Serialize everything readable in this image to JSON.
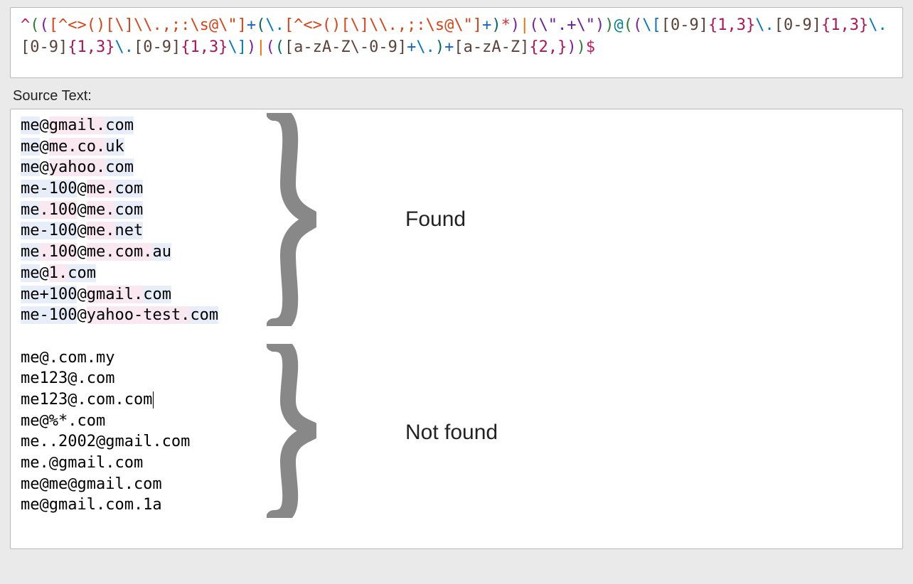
{
  "regex": {
    "tokens": [
      {
        "t": "^",
        "c": "c-anchor"
      },
      {
        "t": "(",
        "c": "c-group"
      },
      {
        "t": "(",
        "c": "c-group2"
      },
      {
        "t": "[^<>()[\\]\\\\.,;:\\s@\\\"]",
        "c": "c-charcls"
      },
      {
        "t": "+",
        "c": "c-quant"
      },
      {
        "t": "(",
        "c": "c-group3"
      },
      {
        "t": "\\.",
        "c": "c-esc"
      },
      {
        "t": "[^<>()[\\]\\\\.,;:\\s@\\\"]",
        "c": "c-charcls"
      },
      {
        "t": "+",
        "c": "c-quant"
      },
      {
        "t": ")",
        "c": "c-group3"
      },
      {
        "t": "*",
        "c": "c-star"
      },
      {
        "t": ")",
        "c": "c-group2"
      },
      {
        "t": "|",
        "c": "c-alt"
      },
      {
        "t": "(",
        "c": "c-group2"
      },
      {
        "t": "\\\".+\\\"",
        "c": "c-special"
      },
      {
        "t": ")",
        "c": "c-group2"
      },
      {
        "t": ")",
        "c": "c-group"
      },
      {
        "t": "@",
        "c": "c-at"
      },
      {
        "t": "(",
        "c": "c-group"
      },
      {
        "t": "(",
        "c": "c-group2"
      },
      {
        "t": "\\[",
        "c": "c-esc"
      },
      {
        "t": "[0-9]",
        "c": "c-charcls2"
      },
      {
        "t": "{1,3}",
        "c": "c-quant2"
      },
      {
        "t": "\\.",
        "c": "c-esc"
      },
      {
        "t": "[0-9]",
        "c": "c-charcls2"
      },
      {
        "t": "{1,3}",
        "c": "c-quant2"
      },
      {
        "t": "\\.",
        "c": "c-esc"
      },
      {
        "t": "[0-9]",
        "c": "c-charcls2"
      },
      {
        "t": "{1,3}",
        "c": "c-quant2"
      },
      {
        "t": "\\.",
        "c": "c-esc"
      },
      {
        "t": "[0-9]",
        "c": "c-charcls2"
      },
      {
        "t": "{1,3}",
        "c": "c-quant2"
      },
      {
        "t": "\\]",
        "c": "c-esc"
      },
      {
        "t": ")",
        "c": "c-group2"
      },
      {
        "t": "|",
        "c": "c-alt"
      },
      {
        "t": "(",
        "c": "c-group2"
      },
      {
        "t": "(",
        "c": "c-group3"
      },
      {
        "t": "[a-zA-Z\\-0-9]",
        "c": "c-charcls2"
      },
      {
        "t": "+",
        "c": "c-quant"
      },
      {
        "t": "\\.",
        "c": "c-esc"
      },
      {
        "t": ")",
        "c": "c-group3"
      },
      {
        "t": "+",
        "c": "c-quant"
      },
      {
        "t": "[a-zA-Z]",
        "c": "c-charcls2"
      },
      {
        "t": "{2,}",
        "c": "c-quant2"
      },
      {
        "t": ")",
        "c": "c-group2"
      },
      {
        "t": ")",
        "c": "c-group"
      },
      {
        "t": "$",
        "c": "c-end"
      }
    ]
  },
  "labels": {
    "source_text": "Source Text:",
    "found": "Found",
    "not_found": "Not found"
  },
  "found_rows": [
    {
      "segments": [
        {
          "t": "me",
          "h": "b"
        },
        {
          "t": "@",
          "h": ""
        },
        {
          "t": "gmail.",
          "h": "p"
        },
        {
          "t": "com",
          "h": "b"
        }
      ]
    },
    {
      "segments": [
        {
          "t": "me",
          "h": "b"
        },
        {
          "t": "@",
          "h": ""
        },
        {
          "t": "me.co.",
          "h": "p"
        },
        {
          "t": "uk",
          "h": "b"
        }
      ]
    },
    {
      "segments": [
        {
          "t": "me",
          "h": "b"
        },
        {
          "t": "@",
          "h": ""
        },
        {
          "t": "yahoo.",
          "h": "p"
        },
        {
          "t": "com",
          "h": "b"
        }
      ]
    },
    {
      "segments": [
        {
          "t": "me-100",
          "h": "b"
        },
        {
          "t": "@",
          "h": ""
        },
        {
          "t": "me.",
          "h": "p"
        },
        {
          "t": "com",
          "h": "b"
        }
      ]
    },
    {
      "segments": [
        {
          "t": "me",
          "h": "b"
        },
        {
          "t": ".100",
          "h": "p"
        },
        {
          "t": "@",
          "h": ""
        },
        {
          "t": "me.",
          "h": "p"
        },
        {
          "t": "com",
          "h": "b"
        }
      ]
    },
    {
      "segments": [
        {
          "t": "me-100",
          "h": "b"
        },
        {
          "t": "@",
          "h": ""
        },
        {
          "t": "me.",
          "h": "p"
        },
        {
          "t": "net",
          "h": "b"
        }
      ]
    },
    {
      "segments": [
        {
          "t": "me",
          "h": "b"
        },
        {
          "t": ".100",
          "h": "p"
        },
        {
          "t": "@",
          "h": ""
        },
        {
          "t": "me.com.",
          "h": "p"
        },
        {
          "t": "au",
          "h": "b"
        }
      ]
    },
    {
      "segments": [
        {
          "t": "me",
          "h": "b"
        },
        {
          "t": "@",
          "h": ""
        },
        {
          "t": "1.",
          "h": "p"
        },
        {
          "t": "com",
          "h": "b"
        }
      ]
    },
    {
      "segments": [
        {
          "t": "me+100",
          "h": "b"
        },
        {
          "t": "@",
          "h": ""
        },
        {
          "t": "gmail.",
          "h": "p"
        },
        {
          "t": "com",
          "h": "b"
        }
      ]
    },
    {
      "segments": [
        {
          "t": "me-100",
          "h": "b"
        },
        {
          "t": "@",
          "h": ""
        },
        {
          "t": "yahoo-test.",
          "h": "p"
        },
        {
          "t": "com",
          "h": "b"
        }
      ]
    }
  ],
  "notfound_rows": [
    "me@.com.my",
    "me123@.com",
    "me123@.com.com",
    "me@%*.com",
    "me..2002@gmail.com",
    "me.@gmail.com",
    "me@me@gmail.com",
    "me@gmail.com.1a"
  ],
  "cursor_row_index": 2
}
